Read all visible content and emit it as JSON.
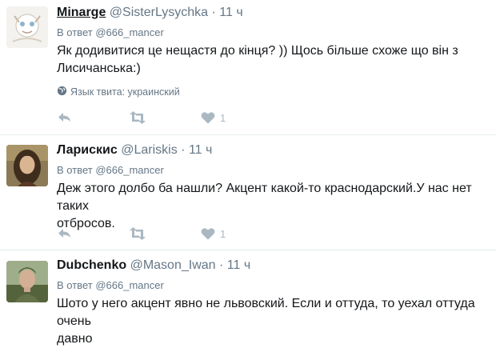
{
  "tweets": [
    {
      "name": "Minarge",
      "handle": "@SisterLysychka",
      "dot": "·",
      "time": "11 ч",
      "reply_prefix": "В ответ",
      "reply_to": "@666_mancer",
      "text_lines": [
        "Як додивитися це нещастя до кінця? )) Щось більше схоже що він з",
        "Лисичанська:)"
      ],
      "lang_label": "Язык твита: украинский",
      "like_count": "1"
    },
    {
      "name": "Ларискис",
      "handle": "@Lariskis",
      "dot": "·",
      "time": "11 ч",
      "reply_prefix": "В ответ",
      "reply_to": "@666_mancer",
      "text_lines": [
        "Деж этого долбо  ба нашли? Акцент какой-то краснодарский.У нас нет таких",
        "отбросов."
      ],
      "like_count": "1"
    },
    {
      "name": "Dubchenko",
      "handle": "@Mason_Iwan",
      "dot": "·",
      "time": "11 ч",
      "reply_prefix": "В ответ",
      "reply_to": "@666_mancer",
      "text_lines": [
        "Шото у него акцент явно не львовский. Если и оттуда, то уехал оттуда очень",
        "давно"
      ]
    }
  ],
  "icons": {
    "reply": "reply-icon",
    "retweet": "retweet-icon",
    "like": "heart-icon",
    "globe": "globe-icon"
  },
  "colors": {
    "action_gray": "#aab8c2",
    "meta_gray": "#657786",
    "separator": "#e6ecf0"
  }
}
